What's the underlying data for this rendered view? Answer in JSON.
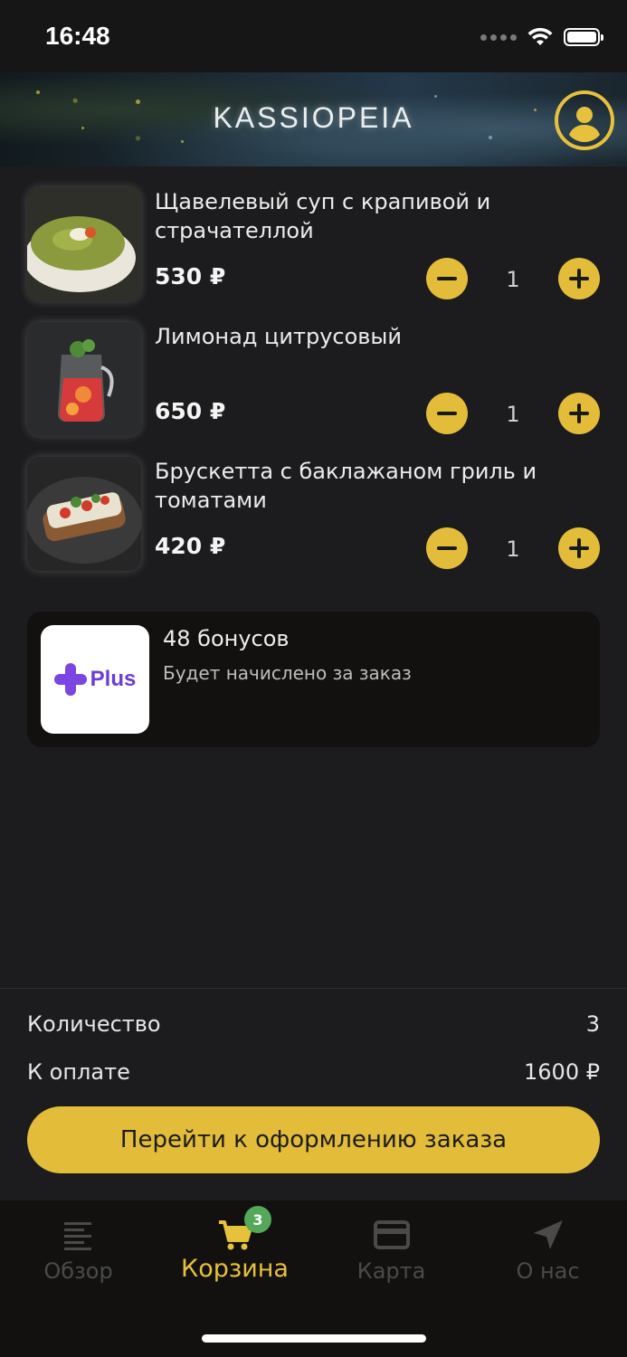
{
  "status_bar": {
    "time": "16:48"
  },
  "header": {
    "logo": "KASSIOPEIA",
    "profile_icon": "user-circle-icon"
  },
  "cart": {
    "items": [
      {
        "name": "Щавелевый суп с крапивой и страчателлой",
        "price": "530 ₽",
        "quantity": "1",
        "image": "soup-bowl"
      },
      {
        "name": "Лимонад цитрусовый",
        "price": "650 ₽",
        "quantity": "1",
        "image": "lemonade-jug"
      },
      {
        "name": "Брускетта с баклажаном гриль и томатами",
        "price": "420 ₽",
        "quantity": "1",
        "image": "bruschetta-plate"
      }
    ]
  },
  "bonus": {
    "logo_text": "Plus",
    "title": "48 бонусов",
    "subtitle": "Будет начислено за заказ"
  },
  "summary": {
    "quantity_label": "Количество",
    "quantity_value": "3",
    "total_label": "К оплате",
    "total_value": "1600 ₽"
  },
  "checkout": {
    "label": "Перейти к оформлению заказа"
  },
  "tabs": [
    {
      "label": "Обзор",
      "icon": "list-icon",
      "active": false
    },
    {
      "label": "Корзина",
      "icon": "cart-icon",
      "active": true,
      "badge": "3"
    },
    {
      "label": "Карта",
      "icon": "card-icon",
      "active": false
    },
    {
      "label": "О нас",
      "icon": "navigation-arrow-icon",
      "active": false
    }
  ],
  "colors": {
    "accent": "#e3bd39",
    "background": "#1c1c1e",
    "badge": "#55a85a",
    "plus_brand": "#7a45e0"
  }
}
